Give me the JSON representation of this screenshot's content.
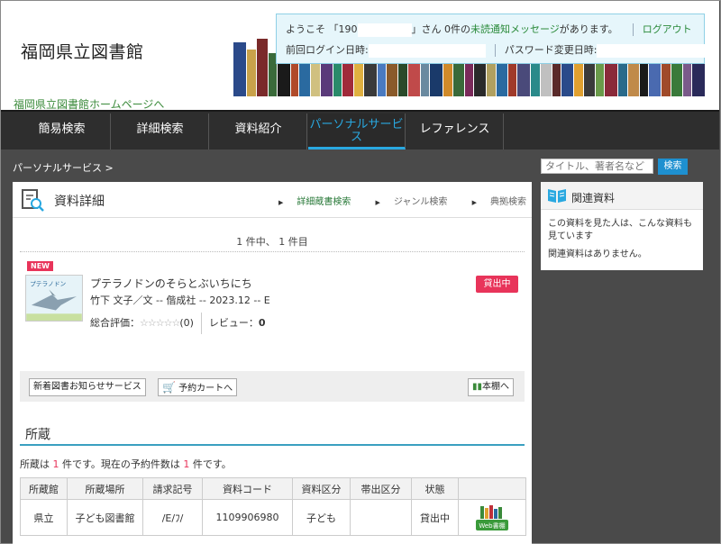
{
  "header": {
    "site_title": "福岡県立図書館",
    "home_link": "福岡県立図書館ホームページへ",
    "welcome_prefix": "ようこそ 「190",
    "welcome_suffix": "」さん 0件の",
    "unread_link": "未読通知メッセージ",
    "welcome_end": "があります。",
    "logout": "ログアウト",
    "last_login_label": "前回ログイン日時:",
    "password_change_label": "パスワード変更日時:"
  },
  "nav": {
    "tabs": [
      "簡易検索",
      "詳細検索",
      "資料紹介",
      "パーソナルサービス",
      "レファレンス"
    ]
  },
  "breadcrumb": "パーソナルサービス >",
  "search": {
    "placeholder": "タイトル、著者名など",
    "button": "検索"
  },
  "detail": {
    "title": "資料詳細",
    "links": [
      "詳細蔵書検索",
      "ジャンル検索",
      "典拠検索"
    ],
    "count_text": "1 件中、 1 件目",
    "new_badge": "NEW",
    "book_title": "プテラノドンのそらとぶいちにち",
    "book_meta": "竹下 文子／文 -- 偕成社 -- 2023.12 -- E",
    "rating_label": "総合評価：",
    "stars": "☆☆☆☆☆",
    "rating_count": "(0)",
    "review_label": "レビュー：",
    "review_count": "0",
    "status": "貸出中",
    "new_books_button": "新着図書お知らせサービス",
    "cart_button": "予約カートへ",
    "shelf_button": "本棚へ"
  },
  "holdings": {
    "title": "所蔵",
    "text_prefix": "所蔵は ",
    "holding_count": "1",
    "text_middle": " 件です。現在の予約件数は ",
    "reserve_count": "1",
    "text_suffix": " 件です。",
    "columns": [
      "所蔵館",
      "所蔵場所",
      "請求記号",
      "資料コード",
      "資料区分",
      "帯出区分",
      "状態",
      ""
    ],
    "rows": [
      [
        "県立",
        "子ども図書館",
        "/E/ﾌ/",
        "1109906980",
        "子ども",
        "",
        "貸出中"
      ]
    ],
    "web_label": "Web書棚"
  },
  "related": {
    "title": "関連資料",
    "text1": "この資料を見た人は、こんな資料も見ています",
    "text2": "関連資料はありません。"
  },
  "colors": {
    "accent_blue": "#29a8e0",
    "nav_bg": "#2e2e2e",
    "badge_pink": "#e8345a",
    "link_green": "#2a8a3a"
  }
}
